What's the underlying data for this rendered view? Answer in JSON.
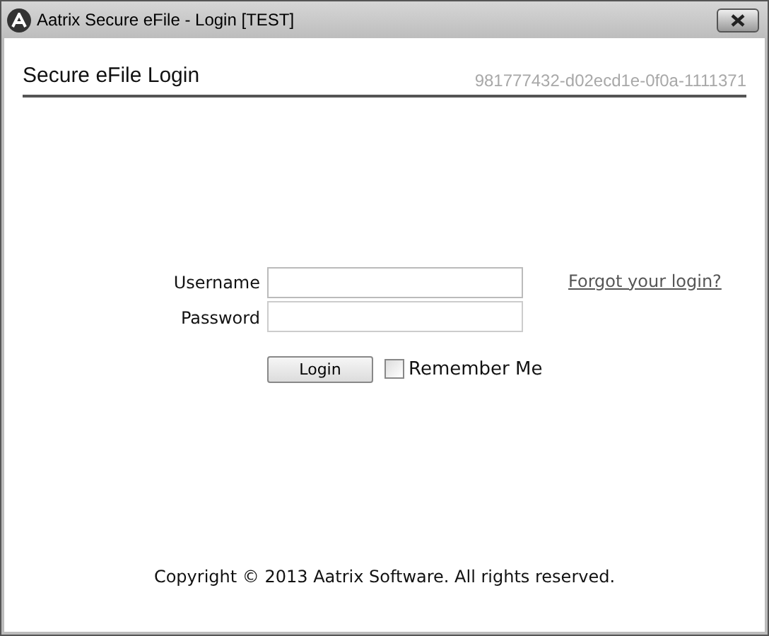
{
  "window": {
    "title": "Aatrix Secure eFile - Login [TEST]"
  },
  "header": {
    "title": "Secure eFile Login",
    "id_code": "981777432-d02ecd1e-0f0a-1111371"
  },
  "form": {
    "username_label": "Username",
    "password_label": "Password",
    "forgot_link": "Forgot your login?",
    "login_button": "Login",
    "remember": {
      "label": "Remember Me",
      "checked": false
    }
  },
  "footer": "Copyright © 2013 Aatrix Software. All rights reserved."
}
